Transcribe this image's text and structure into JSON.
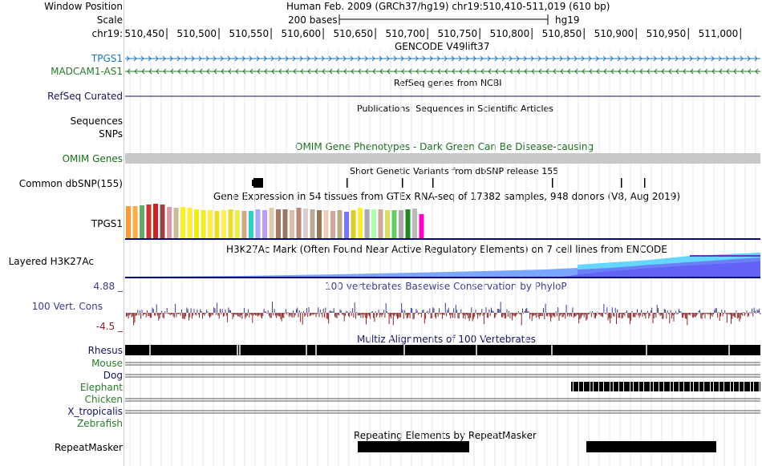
{
  "header": {
    "window_position_label": "Window Position",
    "scale_label": "Scale",
    "chrom_label": "chr19:",
    "assembly_position": "Human Feb. 2009 (GRCh37/hg19)   chr19:510,410-511,019 (610 bp)",
    "scale_text": "200 bases",
    "scale_db": "hg19",
    "ruler_ticks": [
      "510,450",
      "510,500",
      "510,550",
      "510,600",
      "510,650",
      "510,700",
      "510,750",
      "510,800",
      "510,850",
      "510,900",
      "510,950",
      "511,000"
    ],
    "gencode_title": "GENCODE V49lift37"
  },
  "tracks": {
    "tpgs1": {
      "label": "TPGS1",
      "color": "#1f77b4"
    },
    "madcam1": {
      "label": "MADCAM1-AS1",
      "color": "#2a7a2a"
    },
    "refseq": {
      "label": "RefSeq Curated",
      "title": "RefSeq genes from NCBI",
      "color": "#14145a"
    },
    "publications": {
      "title": "Publications: Sequences in Scientific Articles"
    },
    "sequences": {
      "label": "Sequences"
    },
    "snps": {
      "label": "SNPs"
    },
    "omim": {
      "label": "OMIM Genes",
      "title": "OMIM Gene Phenotypes - Dark Green Can Be Disease-causing",
      "color": "#1a6e1a"
    },
    "dbsnp": {
      "label": "Common dbSNP(155)",
      "title": "Short Genetic Variants from dbSNP release 155"
    },
    "gtex": {
      "label": "TPGS1",
      "title": "Gene Expression in 54 tissues from GTEx RNA-seq of 17382 samples, 948 donors (V8, Aug 2019)"
    },
    "h3k27ac": {
      "label": "Layered H3K27Ac",
      "title": "H3K27Ac Mark (Often Found Near Active Regulatory Elements) on 7 cell lines from ENCODE"
    },
    "phylop": {
      "label": "100 Vert. Cons",
      "max": "4.88 _",
      "min": "-4.5 _",
      "title": "100 vertebrates Basewise Conservation by PhyloP",
      "color": "#3c3c8c"
    },
    "multiz": {
      "title": "Multiz Alignments of 100 Vertebrates",
      "species": [
        {
          "name": "Rhesus",
          "color": "#14145a"
        },
        {
          "name": "Mouse",
          "color": "#2a7a2a"
        },
        {
          "name": "Dog",
          "color": "#14145a"
        },
        {
          "name": "Elephant",
          "color": "#2a7a2a"
        },
        {
          "name": "Chicken",
          "color": "#2a7a2a"
        },
        {
          "name": "X_tropicalis",
          "color": "#14145a"
        },
        {
          "name": "Zebrafish",
          "color": "#2a7a2a"
        }
      ]
    },
    "repeatmasker": {
      "label": "RepeatMasker",
      "title": "Repeating Elements by RepeatMasker"
    }
  },
  "gtex_colors": [
    "#ff9933",
    "#ffaa44",
    "#66aa66",
    "#cc3333",
    "#cc2222",
    "#994444",
    "#dd99aa",
    "#ccbb99",
    "#ffee22",
    "#ffee33",
    "#eeee11",
    "#eeee22",
    "#ffee44",
    "#eedd22",
    "#ffee55",
    "#eedd33",
    "#eeee44",
    "#ccaa88",
    "#33cccc",
    "#aaaaff",
    "#bb99ff",
    "#ddccaa",
    "#aa7766",
    "#997766",
    "#ddbbaa",
    "#bb8877",
    "#ddcccc",
    "#bbaa99",
    "#997755",
    "#eeccbb",
    "#ccaa99",
    "#bbaa88",
    "#7777ff",
    "#ddcc22",
    "#ffee33",
    "#aaaaaa",
    "#aaffaa",
    "#ccaa99",
    "#dddd66",
    "#66cc66",
    "#aaaaaa",
    "#228822",
    "#bbbbbb",
    "#ff00cc"
  ]
}
